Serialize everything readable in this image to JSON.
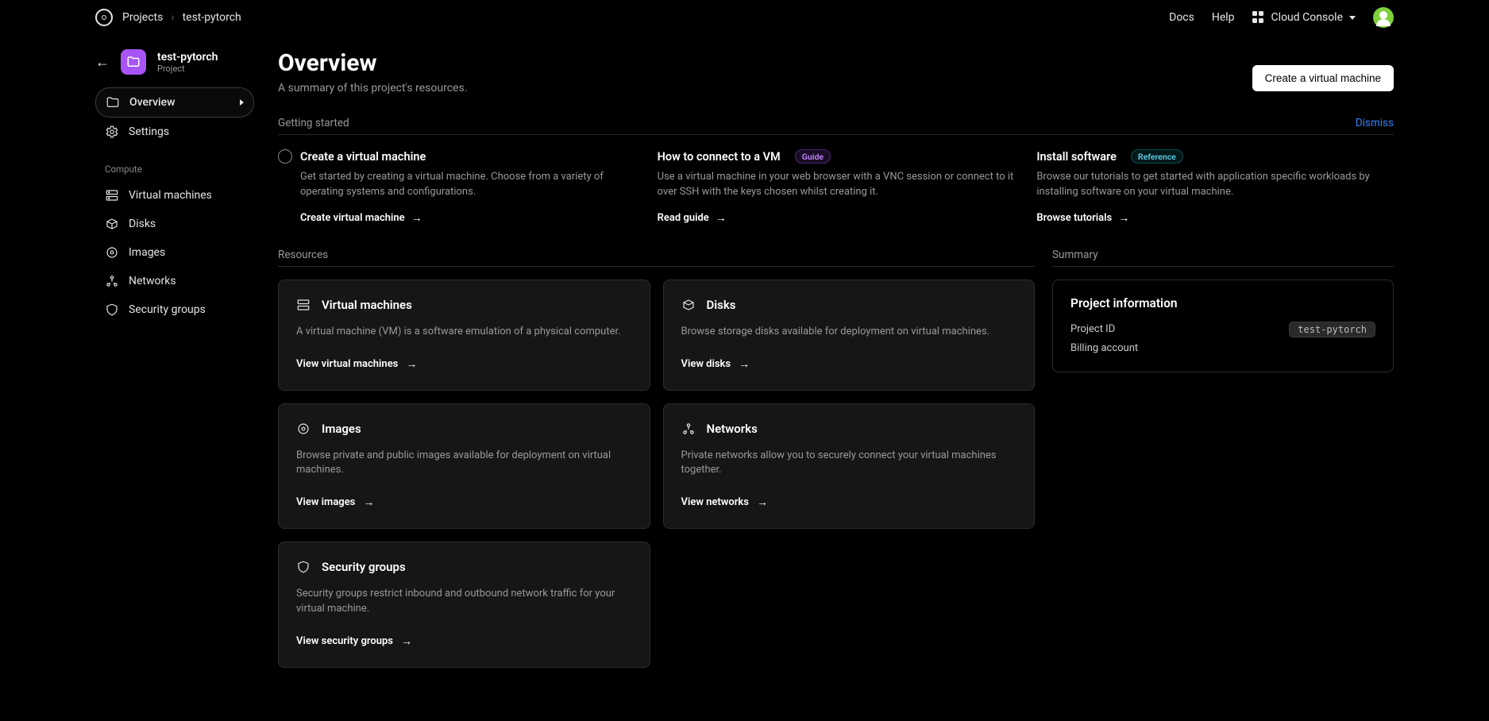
{
  "topbar": {
    "breadcrumb": [
      "Projects",
      "test-pytorch"
    ],
    "links": {
      "docs": "Docs",
      "help": "Help",
      "cloud_console": "Cloud Console"
    }
  },
  "sidebar": {
    "project": {
      "name": "test-pytorch",
      "type": "Project"
    },
    "nav": {
      "overview": "Overview",
      "settings": "Settings"
    },
    "compute_label": "Compute",
    "compute": {
      "vms": "Virtual machines",
      "disks": "Disks",
      "images": "Images",
      "networks": "Networks",
      "security": "Security groups"
    }
  },
  "page": {
    "title": "Overview",
    "subtitle": "A summary of this project's resources.",
    "create_vm_btn": "Create a virtual machine"
  },
  "getting_started": {
    "label": "Getting started",
    "dismiss": "Dismiss",
    "items": [
      {
        "title": "Create a virtual machine",
        "desc": "Get started by creating a virtual machine. Choose from a variety of operating systems and configurations.",
        "link": "Create virtual machine"
      },
      {
        "title": "How to connect to a VM",
        "badge": "Guide",
        "desc": "Use a virtual machine in your web browser with a VNC session or connect to it over SSH with the keys chosen whilst creating it.",
        "link": "Read guide"
      },
      {
        "title": "Install software",
        "badge": "Reference",
        "desc": "Browse our tutorials to get started with application specific workloads by installing software on your virtual machine.",
        "link": "Browse tutorials"
      }
    ]
  },
  "resources": {
    "label": "Resources",
    "cards": {
      "vms": {
        "title": "Virtual machines",
        "desc": "A virtual machine (VM) is a software emulation of a physical computer.",
        "link": "View virtual machines"
      },
      "disks": {
        "title": "Disks",
        "desc": "Browse storage disks available for deployment on virtual machines.",
        "link": "View disks"
      },
      "images": {
        "title": "Images",
        "desc": "Browse private and public images available for deployment on virtual machines.",
        "link": "View images"
      },
      "networks": {
        "title": "Networks",
        "desc": "Private networks allow you to securely connect your virtual machines together.",
        "link": "View networks"
      },
      "security": {
        "title": "Security groups",
        "desc": "Security groups restrict inbound and outbound network traffic for your virtual machine.",
        "link": "View security groups"
      }
    }
  },
  "summary": {
    "label": "Summary",
    "card_title": "Project information",
    "rows": {
      "project_id_label": "Project ID",
      "project_id_value": "test-pytorch",
      "billing_label": "Billing account"
    }
  }
}
